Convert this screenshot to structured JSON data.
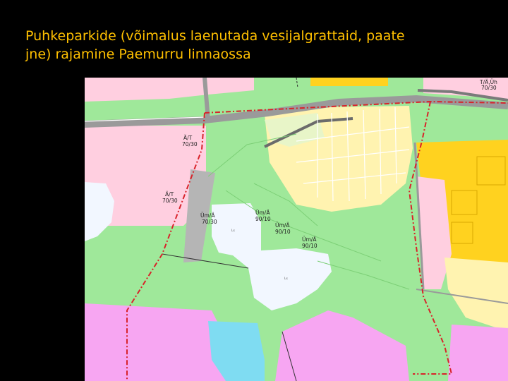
{
  "slide": {
    "title_line1": "Puhkeparkide (võimalus laenutada vesijalgrattaid, paate",
    "title_line2": "jne) rajamine Paemurru linnaossa"
  },
  "map": {
    "zone_labels": [
      {
        "code": "Ä/T",
        "value": "70/30"
      },
      {
        "code": "Ä/T",
        "value": "70/30"
      },
      {
        "code": "Üm/Ä",
        "value": "70/30"
      },
      {
        "code": "Üm/Ä",
        "value": "90/10"
      },
      {
        "code": "Üm/Ä",
        "value": "90/10"
      },
      {
        "code": "Üm/Ä",
        "value": "90/10"
      },
      {
        "code": "T/Ä,Üh",
        "value": "70/30"
      }
    ],
    "minor_labels": [
      "Ls",
      "Ls"
    ],
    "colors": {
      "park_green": "#9fe89a",
      "forest_green": "#b8f0b0",
      "residential_yellow": "#fff3b0",
      "dense_yellow": "#ffd21f",
      "commercial_pink": "#f7a6f2",
      "light_pink": "#ffcfe0",
      "water_white": "#f2f7ff",
      "water_cyan": "#7fdcf2",
      "road_gray": "#b5b5b5",
      "boundary_red": "#d8232a",
      "title_color": "#ffc000"
    }
  }
}
